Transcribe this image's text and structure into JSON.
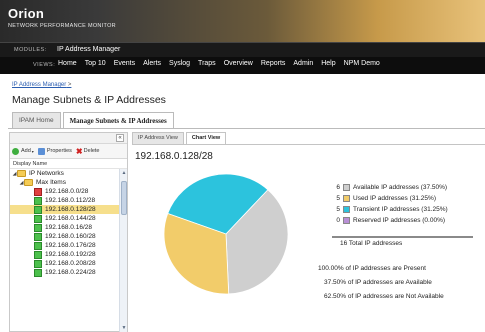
{
  "header": {
    "brand_title": "Orion",
    "brand_subtitle": "NETWORK PERFORMANCE MONITOR"
  },
  "modules_bar": {
    "label": "MODULES:",
    "value": "IP Address Manager"
  },
  "views_bar": {
    "label": "VIEWS:",
    "items": [
      "Home",
      "Top 10",
      "Events",
      "Alerts",
      "Syslog",
      "Traps",
      "Overview",
      "Reports",
      "Admin",
      "Help",
      "NPM Demo"
    ]
  },
  "breadcrumb": {
    "link": "IP Address Manager",
    "sep": " >"
  },
  "page_title": "Manage Subnets & IP Addresses",
  "main_tabs": [
    {
      "label": "IPAM Home",
      "active": false
    },
    {
      "label": "Manage Subnets & IP Addresses",
      "active": true
    }
  ],
  "left_panel": {
    "collapse_glyph": "«",
    "toolbar": {
      "add": "Add",
      "properties": "Properties",
      "delete": "Delete"
    },
    "column_header": "Display Name",
    "tree": {
      "root": "IP Networks",
      "group": "Max Items",
      "subnets": [
        "192.168.0.0/28",
        "192.168.0.112/28",
        "192.168.0.128/28",
        "192.168.0.144/28",
        "192.168.0.16/28",
        "192.168.0.160/28",
        "192.168.0.176/28",
        "192.168.0.192/28",
        "192.168.0.208/28",
        "192.168.0.224/28"
      ],
      "selected_index": 2
    }
  },
  "right_panel": {
    "subtabs": [
      {
        "label": "IP Address View",
        "active": false
      },
      {
        "label": "Chart View",
        "active": true
      }
    ],
    "subnet_title": "192.168.0.128/28",
    "legend": [
      {
        "count": "6",
        "label": "Available IP addresses (37.50%)",
        "color": "#cfcfcf"
      },
      {
        "count": "5",
        "label": "Used IP addresses (31.25%)",
        "color": "#f2cc6a"
      },
      {
        "count": "5",
        "label": "Transient IP addresses (31.25%)",
        "color": "#2cc3dd"
      },
      {
        "count": "0",
        "label": "Reserved IP addresses (0.00%)",
        "color": "#b98fd6"
      }
    ],
    "total": "16 Total IP addresses",
    "stats": [
      "100.00% of IP addresses are Present",
      "37.50% of IP addresses are Available",
      "62.50% of IP addresses are Not Available"
    ]
  },
  "chart_data": {
    "type": "pie",
    "categories": [
      "Available",
      "Used",
      "Transient",
      "Reserved"
    ],
    "values": [
      6,
      5,
      5,
      0
    ],
    "colors": [
      "#cfcfcf",
      "#f2cc6a",
      "#2cc3dd",
      "#b98fd6"
    ]
  }
}
